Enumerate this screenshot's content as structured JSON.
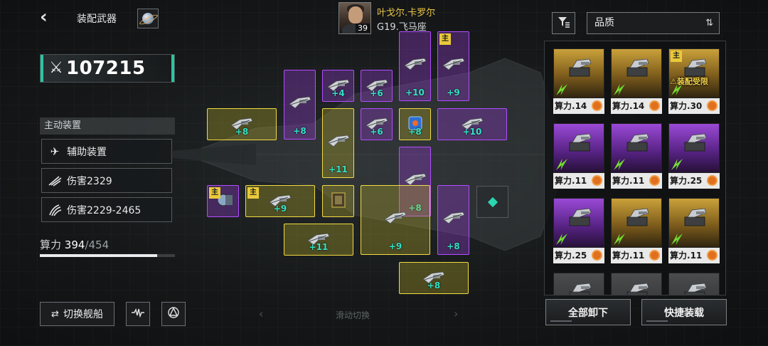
{
  "header": {
    "title": "装配武器",
    "back_icon": "back-chevron-icon",
    "planet_icon": "planet-icon"
  },
  "power": {
    "value": "107215",
    "icon": "crossed-swords-icon"
  },
  "pilot": {
    "name": "叶戈尔.卡罗尔",
    "ship": "G19.飞马座",
    "level": "39"
  },
  "active_device": {
    "header": "主动装置",
    "rows": [
      {
        "icon": "jet-icon",
        "label": "辅助装置"
      },
      {
        "icon": "slash-damage-icon",
        "label": "伤害2329"
      },
      {
        "icon": "claw-damage-icon",
        "label": "伤害2229-2465"
      }
    ]
  },
  "capacity": {
    "label": "算力",
    "current": "394",
    "max": "/454",
    "fraction": 0.868
  },
  "bottom_left": {
    "switch_label": "切换舰船",
    "switch_icon": "swap-arrows-icon",
    "wave_icon": "waveform-icon",
    "emblem_icon": "emblem-icon"
  },
  "grid": {
    "main_tag": "主",
    "slots": [
      {
        "level": "+10"
      },
      {
        "level": "+9"
      },
      {
        "level": "+4"
      },
      {
        "level": "+6"
      },
      {
        "level": "+8"
      },
      {
        "level": "+8"
      },
      {
        "level": "+6"
      },
      {
        "level": "+8"
      },
      {
        "level": "+10"
      },
      {
        "level": "+11"
      },
      {
        "level": "+8"
      },
      {
        "level": "+9"
      },
      {
        "level": "+9"
      },
      {
        "level": "+8"
      },
      {
        "level": "+11"
      },
      {
        "level": "+8"
      }
    ]
  },
  "scroll_hint": "滑动切换",
  "inventory": {
    "filter_icon": "filter-icon",
    "sort_label": "品质",
    "sort_icon": "sort-arrows-icon",
    "power_prefix": "算力.",
    "restricted_label": "装配受限",
    "main_tag": "主",
    "cards": [
      {
        "power": "14",
        "rarity": "gold"
      },
      {
        "power": "14",
        "rarity": "gold"
      },
      {
        "power": "30",
        "rarity": "gold",
        "restricted": true,
        "main": true
      },
      {
        "power": "11",
        "rarity": "purple"
      },
      {
        "power": "11",
        "rarity": "purple"
      },
      {
        "power": "25",
        "rarity": "purple"
      },
      {
        "power": "25",
        "rarity": "purple"
      },
      {
        "power": "11",
        "rarity": "gold"
      },
      {
        "power": "11",
        "rarity": "gold"
      }
    ],
    "unload_all_label": "全部卸下",
    "quick_equip_label": "快捷装载"
  }
}
